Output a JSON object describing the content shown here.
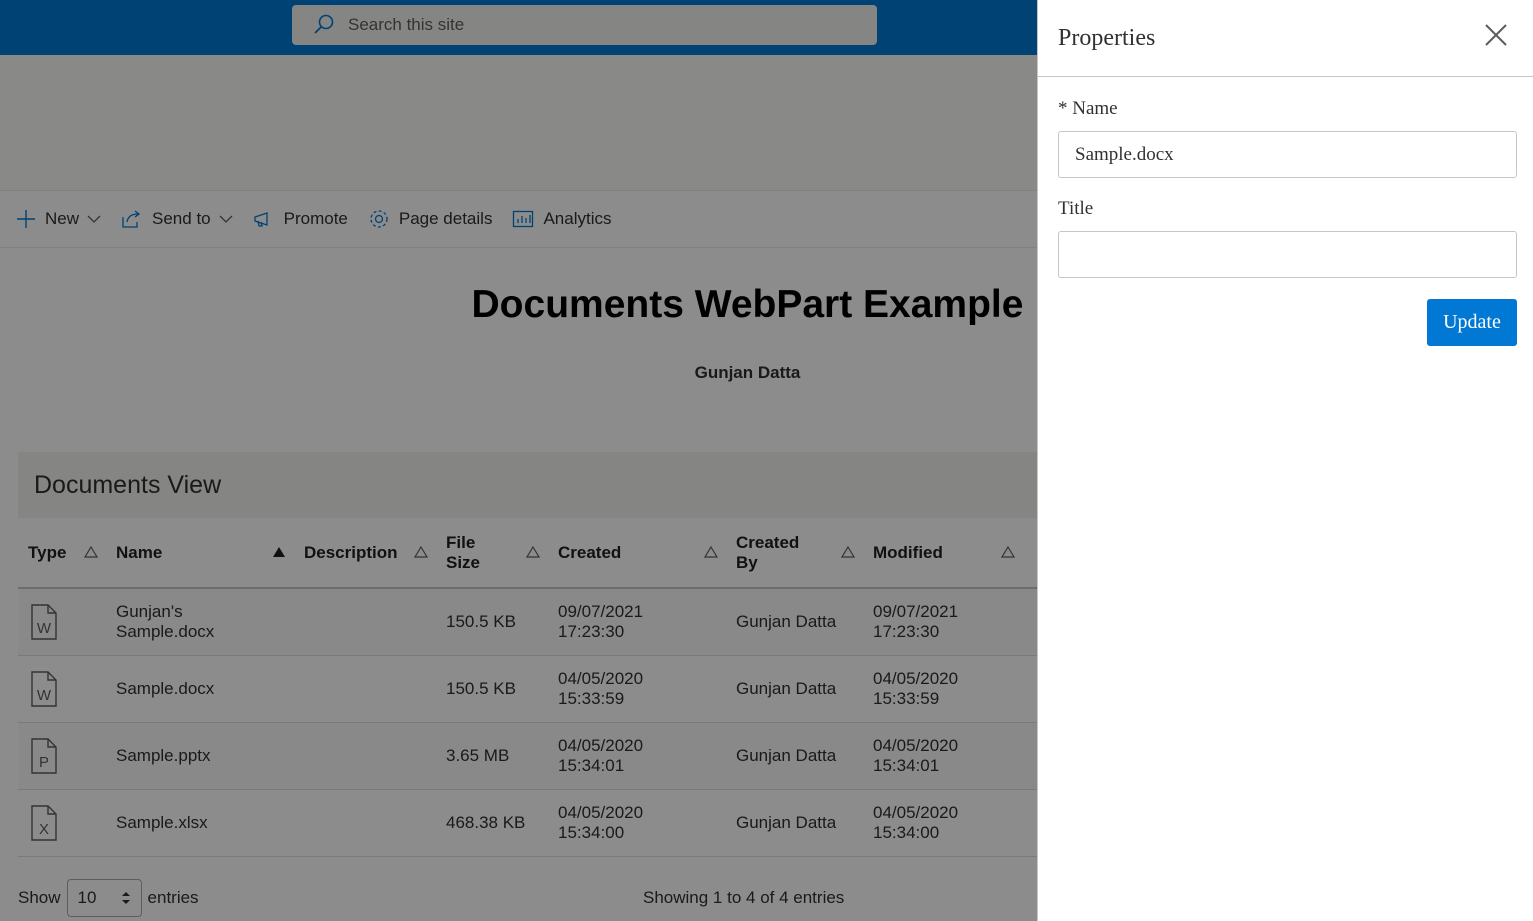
{
  "search": {
    "placeholder": "Search this site"
  },
  "commands": {
    "new": "New",
    "send_to": "Send to",
    "promote": "Promote",
    "page_details": "Page details",
    "analytics": "Analytics"
  },
  "page": {
    "title": "Documents WebPart Example",
    "author": "Gunjan Datta"
  },
  "documents_view": {
    "title": "Documents View",
    "columns": [
      {
        "lines": [
          "Type"
        ]
      },
      {
        "lines": [
          "Name"
        ]
      },
      {
        "lines": [
          "Description"
        ]
      },
      {
        "lines": [
          "File",
          "Size"
        ]
      },
      {
        "lines": [
          "Created"
        ]
      },
      {
        "lines": [
          "Created",
          "By"
        ]
      },
      {
        "lines": [
          "Modified"
        ]
      }
    ],
    "rows": [
      {
        "type_icon": "word-file-icon",
        "type_letter": "W",
        "name": [
          "Gunjan's",
          "Sample.docx"
        ],
        "description": "",
        "size": "150.5 KB",
        "created": [
          "09/07/2021",
          "17:23:30"
        ],
        "created_by": "Gunjan Datta",
        "modified": [
          "09/07/2021",
          "17:23:30"
        ]
      },
      {
        "type_icon": "word-file-icon",
        "type_letter": "W",
        "name": [
          "Sample.docx"
        ],
        "description": "",
        "size": "150.5 KB",
        "created": [
          "04/05/2020",
          "15:33:59"
        ],
        "created_by": "Gunjan Datta",
        "modified": [
          "04/05/2020",
          "15:33:59"
        ]
      },
      {
        "type_icon": "powerpoint-file-icon",
        "type_letter": "P",
        "name": [
          "Sample.pptx"
        ],
        "description": "",
        "size": "3.65 MB",
        "created": [
          "04/05/2020",
          "15:34:01"
        ],
        "created_by": "Gunjan Datta",
        "modified": [
          "04/05/2020",
          "15:34:01"
        ]
      },
      {
        "type_icon": "excel-file-icon",
        "type_letter": "X",
        "name": [
          "Sample.xlsx"
        ],
        "description": "",
        "size": "468.38 KB",
        "created": [
          "04/05/2020",
          "15:34:00"
        ],
        "created_by": "Gunjan Datta",
        "modified": [
          "04/05/2020",
          "15:34:00"
        ]
      }
    ],
    "footer": {
      "show_label": "Show",
      "page_size": "10",
      "entries_label": "entries",
      "showing_text": "Showing 1 to 4 of 4 entries"
    }
  },
  "panel": {
    "title": "Properties",
    "name_label": "* Name",
    "name_value": "Sample.docx",
    "title_label": "Title",
    "title_value": "",
    "update_label": "Update"
  },
  "colors": {
    "suite_bar": "#0078d4",
    "button": "#0078d4"
  }
}
